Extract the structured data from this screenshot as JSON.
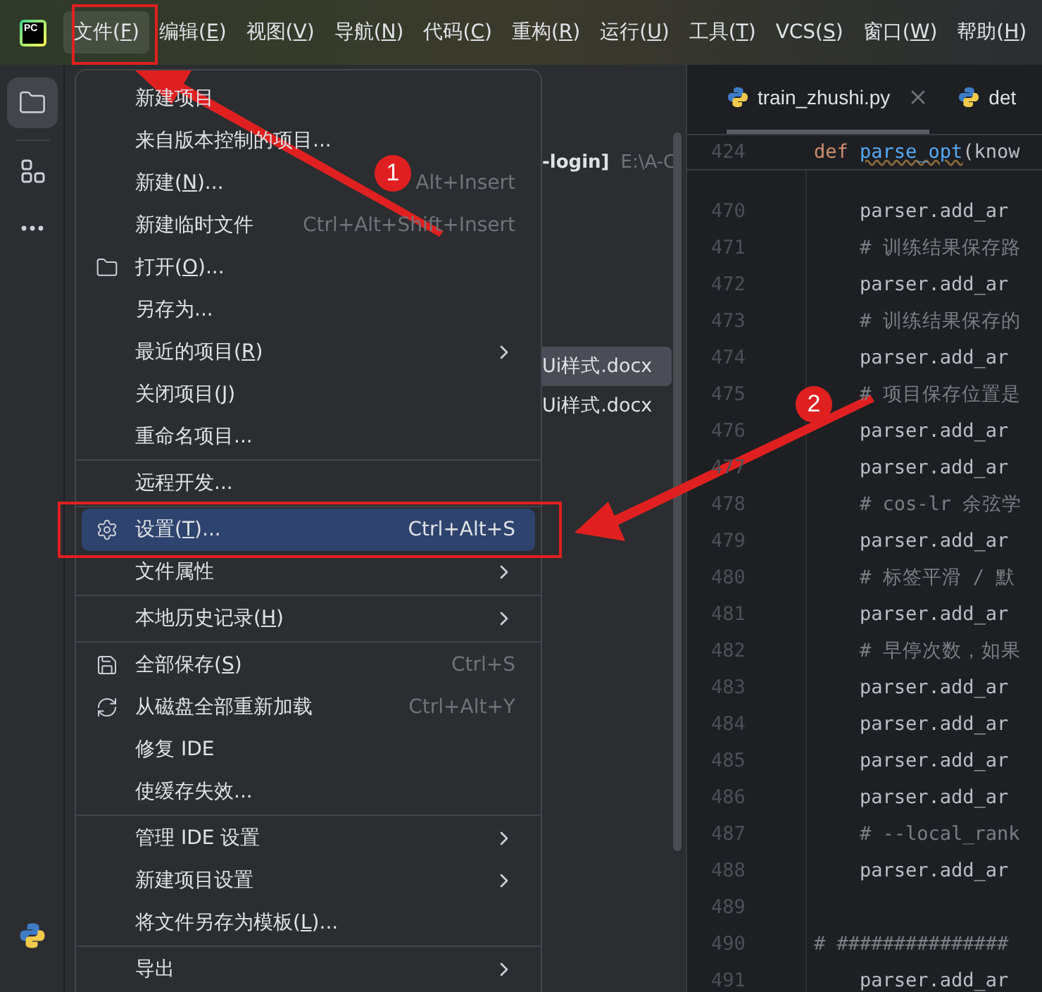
{
  "logo": "PC",
  "menubar": [
    {
      "label": "文件(F)",
      "selected": true
    },
    {
      "label": "编辑(E)",
      "selected": false
    },
    {
      "label": "视图(V)",
      "selected": false
    },
    {
      "label": "导航(N)",
      "selected": false
    },
    {
      "label": "代码(C)",
      "selected": false
    },
    {
      "label": "重构(R)",
      "selected": false
    },
    {
      "label": "运行(U)",
      "selected": false
    },
    {
      "label": "工具(T)",
      "selected": false
    },
    {
      "label": "VCS(S)",
      "selected": false
    },
    {
      "label": "窗口(W)",
      "selected": false
    },
    {
      "label": "帮助(H)",
      "selected": false
    }
  ],
  "toolbar": [
    {
      "kind": "folder",
      "selected": true
    },
    {
      "kind": "structure",
      "selected": false
    },
    {
      "kind": "more",
      "selected": false
    },
    {
      "kind": "python",
      "selected": false
    }
  ],
  "project": {
    "header": "-login]",
    "path": "E:\\A-C",
    "files": [
      {
        "name": "Ui样式.docx",
        "selected": true
      },
      {
        "name": "Ui样式.docx",
        "selected": false
      }
    ]
  },
  "menu": {
    "groups": [
      [
        {
          "label": "新建项目",
          "kind": "plain",
          "selected": false,
          "submenu": false
        },
        {
          "label": "来自版本控制的项目...",
          "kind": "plain",
          "selected": false,
          "submenu": false
        },
        {
          "label": "新建(N)...",
          "kind": "plain",
          "shortcut": "Alt+Insert",
          "selected": false,
          "submenu": false
        },
        {
          "label": "新建临时文件",
          "kind": "plain",
          "shortcut": "Ctrl+Alt+Shift+Insert",
          "selected": false,
          "submenu": false
        },
        {
          "label": "打开(O)...",
          "kind": "folder",
          "selected": false,
          "submenu": false
        },
        {
          "label": "另存为...",
          "kind": "plain",
          "selected": false,
          "submenu": false
        },
        {
          "label": "最近的项目(R)",
          "kind": "plain",
          "selected": false,
          "submenu": true
        },
        {
          "label": "关闭项目(J)",
          "kind": "plain",
          "selected": false,
          "submenu": false
        },
        {
          "label": "重命名项目...",
          "kind": "plain",
          "selected": false,
          "submenu": false
        }
      ],
      [
        {
          "label": "远程开发...",
          "kind": "plain",
          "selected": false,
          "submenu": false
        }
      ],
      [
        {
          "label": "设置(T)...",
          "kind": "gear",
          "shortcut": "Ctrl+Alt+S",
          "selected": true,
          "submenu": false
        },
        {
          "label": "文件属性",
          "kind": "plain",
          "selected": false,
          "submenu": true
        }
      ],
      [
        {
          "label": "本地历史记录(H)",
          "kind": "plain",
          "selected": false,
          "submenu": true
        }
      ],
      [
        {
          "label": "全部保存(S)",
          "kind": "save",
          "shortcut": "Ctrl+S",
          "selected": false,
          "submenu": false
        },
        {
          "label": "从磁盘全部重新加载",
          "kind": "reload",
          "shortcut": "Ctrl+Alt+Y",
          "selected": false,
          "submenu": false
        },
        {
          "label": "修复 IDE",
          "kind": "plain",
          "selected": false,
          "submenu": false
        },
        {
          "label": "使缓存失效...",
          "kind": "plain",
          "selected": false,
          "submenu": false
        }
      ],
      [
        {
          "label": "管理 IDE 设置",
          "kind": "plain",
          "selected": false,
          "submenu": true
        },
        {
          "label": "新建项目设置",
          "kind": "plain",
          "selected": false,
          "submenu": true
        },
        {
          "label": "将文件另存为模板(L)...",
          "kind": "plain",
          "selected": false,
          "submenu": false
        }
      ],
      [
        {
          "label": "导出",
          "kind": "plain",
          "selected": false,
          "submenu": true
        }
      ]
    ]
  },
  "editor": {
    "tabs": [
      {
        "label": "train_zhushi.py",
        "selected": true,
        "closable": true
      },
      {
        "label": "det",
        "selected": false,
        "closable": false
      }
    ],
    "sticky": {
      "number": "424",
      "tokens": [
        {
          "text": "def ",
          "kind": "keyword"
        },
        {
          "text": "parse_opt",
          "kind": "function"
        },
        {
          "text": "(know",
          "kind": "plain"
        }
      ]
    },
    "lines": [
      {
        "number": "470",
        "text": "    parser.add_ar",
        "kind": "code"
      },
      {
        "number": "471",
        "text": "    # 训练结果保存路",
        "kind": "comment"
      },
      {
        "number": "472",
        "text": "    parser.add_ar",
        "kind": "code"
      },
      {
        "number": "473",
        "text": "    # 训练结果保存的",
        "kind": "comment"
      },
      {
        "number": "474",
        "text": "    parser.add_ar",
        "kind": "code"
      },
      {
        "number": "475",
        "text": "    # 项目保存位置是",
        "kind": "comment"
      },
      {
        "number": "476",
        "text": "    parser.add_ar",
        "kind": "code"
      },
      {
        "number": "477",
        "text": "    parser.add_ar",
        "kind": "code"
      },
      {
        "number": "478",
        "text": "    # cos-lr 余弦学",
        "kind": "comment"
      },
      {
        "number": "479",
        "text": "    parser.add_ar",
        "kind": "code"
      },
      {
        "number": "480",
        "text": "    # 标签平滑 / 默",
        "kind": "comment"
      },
      {
        "number": "481",
        "text": "    parser.add_ar",
        "kind": "code"
      },
      {
        "number": "482",
        "text": "    # 早停次数，如果",
        "kind": "comment"
      },
      {
        "number": "483",
        "text": "    parser.add_ar",
        "kind": "code"
      },
      {
        "number": "484",
        "text": "    parser.add_ar",
        "kind": "code"
      },
      {
        "number": "485",
        "text": "    parser.add_ar",
        "kind": "code"
      },
      {
        "number": "486",
        "text": "    parser.add_ar",
        "kind": "code"
      },
      {
        "number": "487",
        "text": "    # --local_rank",
        "kind": "comment"
      },
      {
        "number": "488",
        "text": "    parser.add_ar",
        "kind": "code"
      },
      {
        "number": "489",
        "kind": "blank"
      },
      {
        "number": "490",
        "text": "# ###############",
        "kind": "comment"
      },
      {
        "number": "491",
        "text": "    parser.add_ar",
        "kind": "code"
      }
    ]
  },
  "annotations": [
    {
      "label": "1"
    },
    {
      "label": "2"
    }
  ]
}
